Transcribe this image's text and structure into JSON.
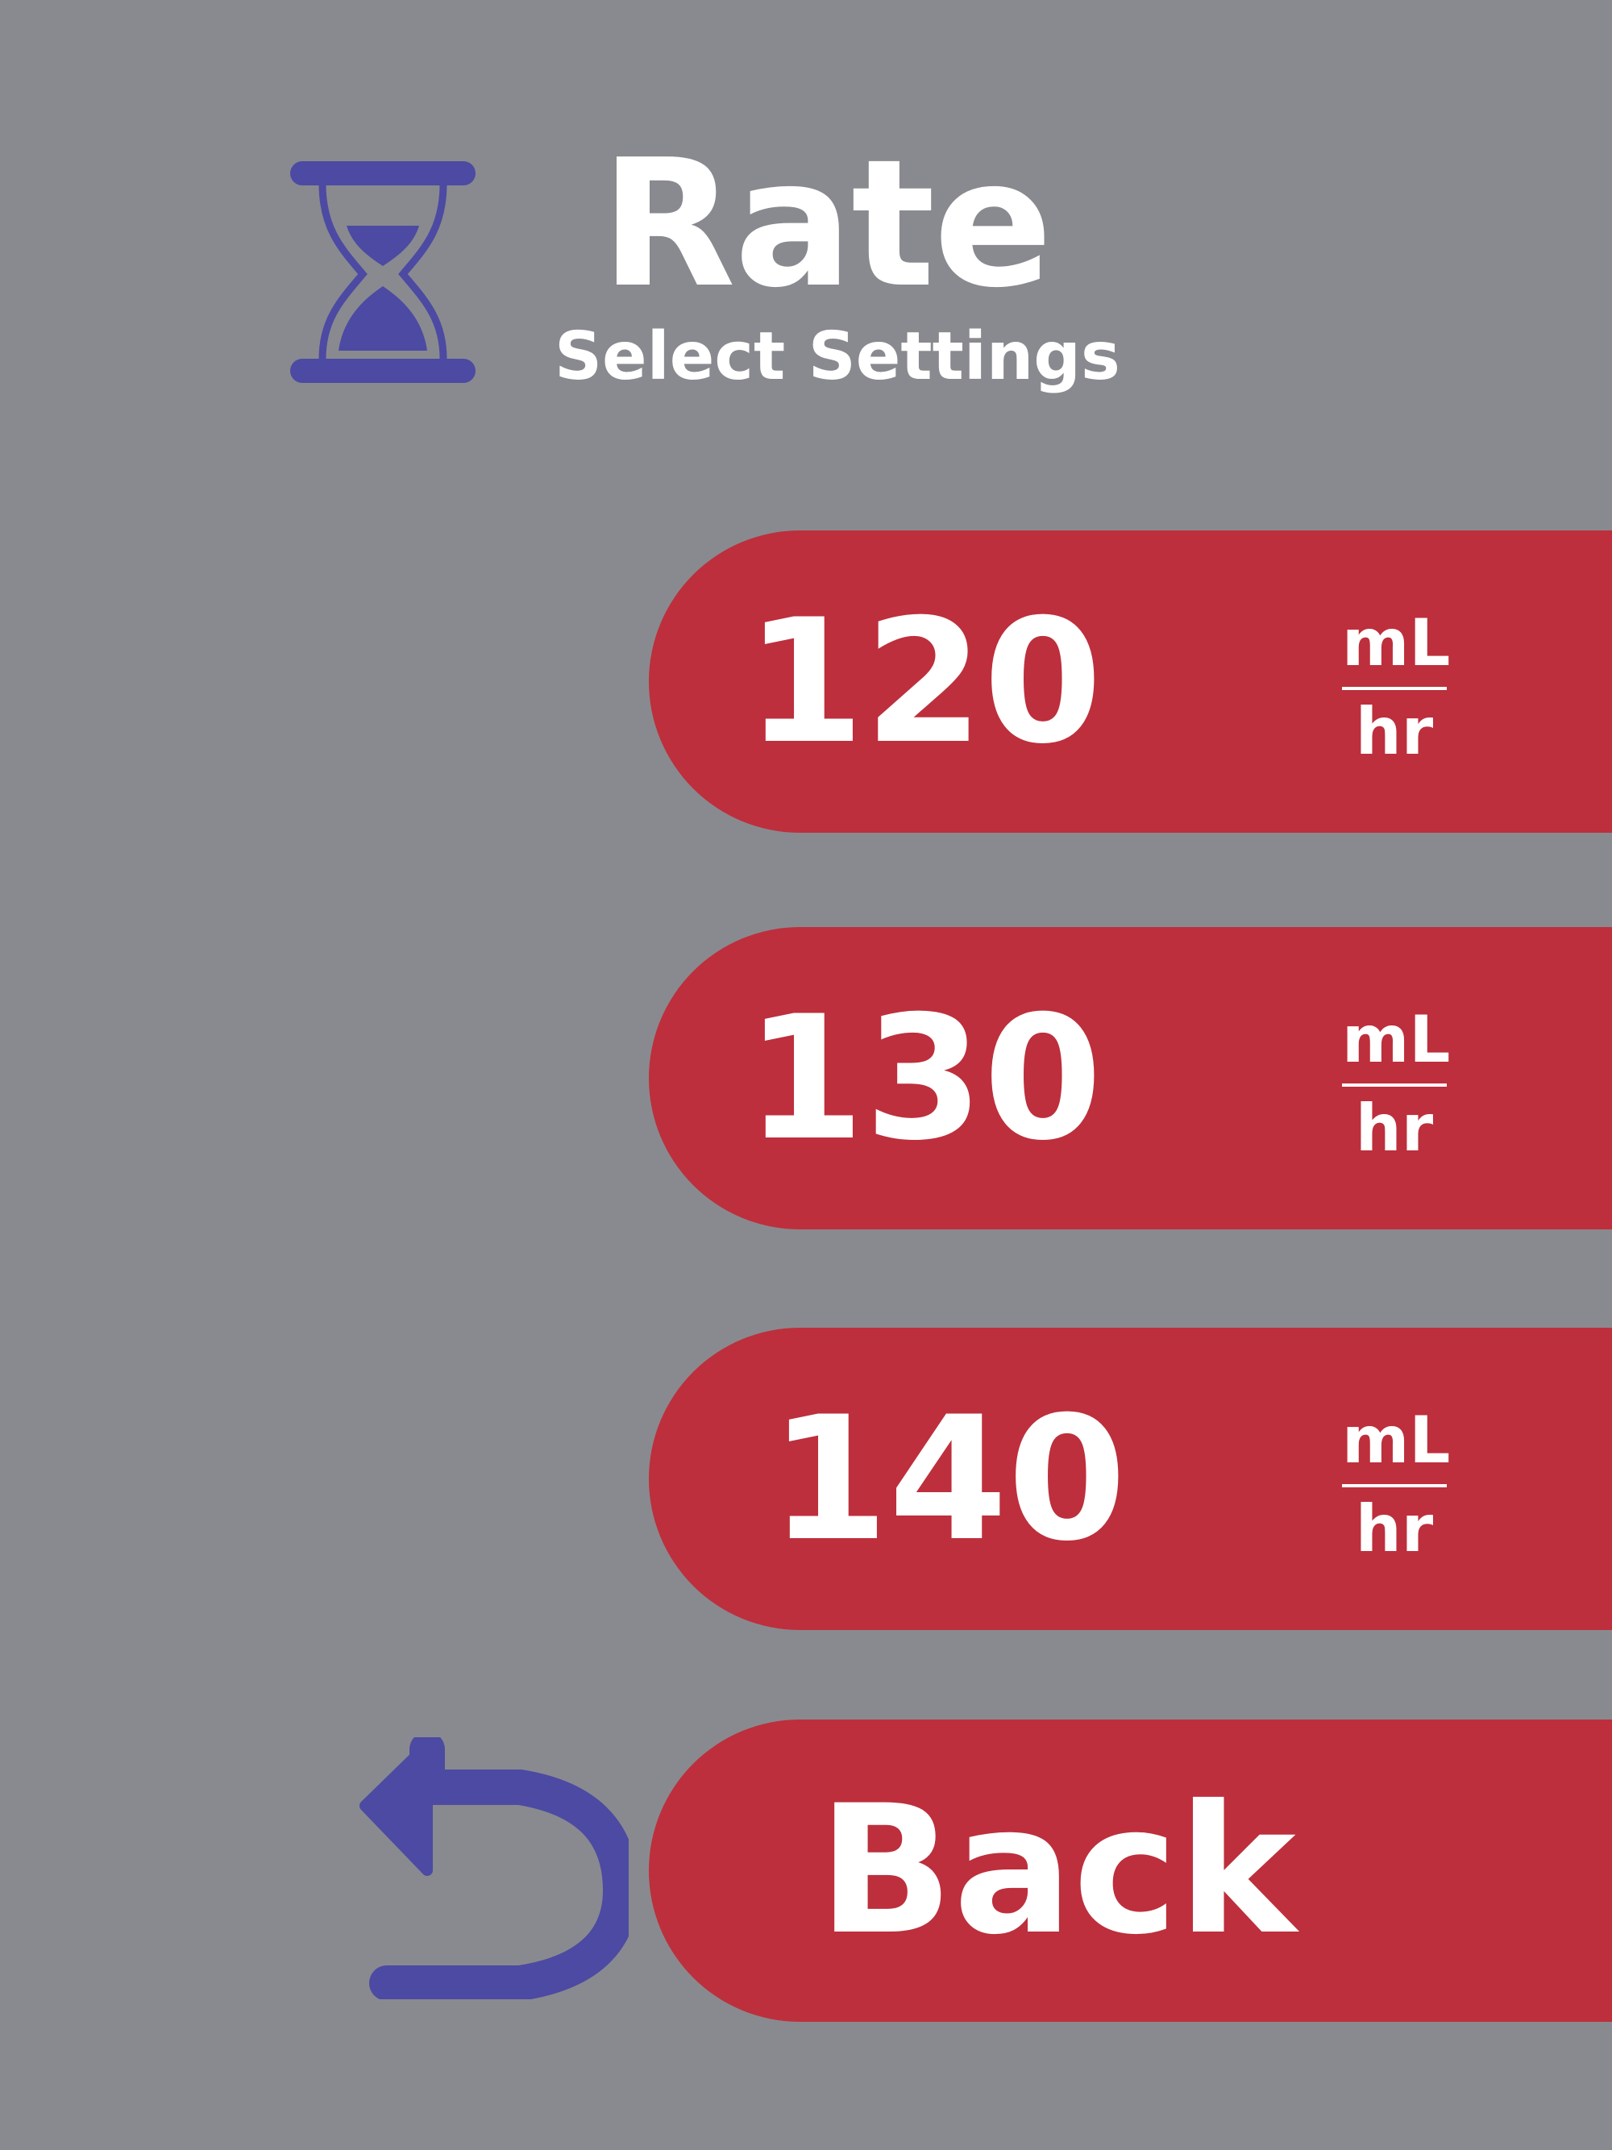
{
  "header": {
    "title": "Rate",
    "subtitle": "Select Settings",
    "icon": "hourglass-icon"
  },
  "options": [
    {
      "value": "120",
      "unit_top": "mL",
      "unit_bottom": "hr"
    },
    {
      "value": "130",
      "unit_top": "mL",
      "unit_bottom": "hr"
    },
    {
      "value": "140",
      "unit_top": "mL",
      "unit_bottom": "hr"
    }
  ],
  "back": {
    "label": "Back",
    "icon": "back-arrow-icon"
  },
  "colors": {
    "background": "#898a8f",
    "button": "#bd2f3c",
    "icon": "#4d4aa3",
    "text": "#ffffff"
  }
}
